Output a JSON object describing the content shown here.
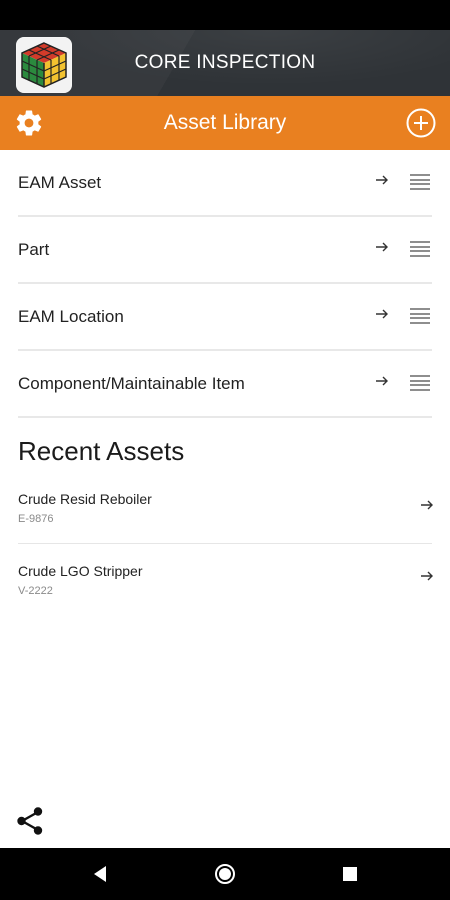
{
  "app": {
    "title": "CORE INSPECTION"
  },
  "toolbar": {
    "title": "Asset Library",
    "settings_icon": "gear-icon",
    "add_icon": "plus-circle-icon"
  },
  "library": {
    "items": [
      {
        "label": "EAM Asset"
      },
      {
        "label": "Part"
      },
      {
        "label": "EAM Location"
      },
      {
        "label": "Component/Maintainable Item"
      }
    ]
  },
  "recent": {
    "heading": "Recent Assets",
    "items": [
      {
        "name": "Crude Resid Reboiler",
        "code": "E-9876"
      },
      {
        "name": "Crude LGO Stripper",
        "code": "V-2222"
      }
    ]
  },
  "footer": {
    "share_icon": "share-icon"
  },
  "colors": {
    "accent": "#e98020",
    "header": "#2f3337",
    "status_bar": "#000000"
  }
}
